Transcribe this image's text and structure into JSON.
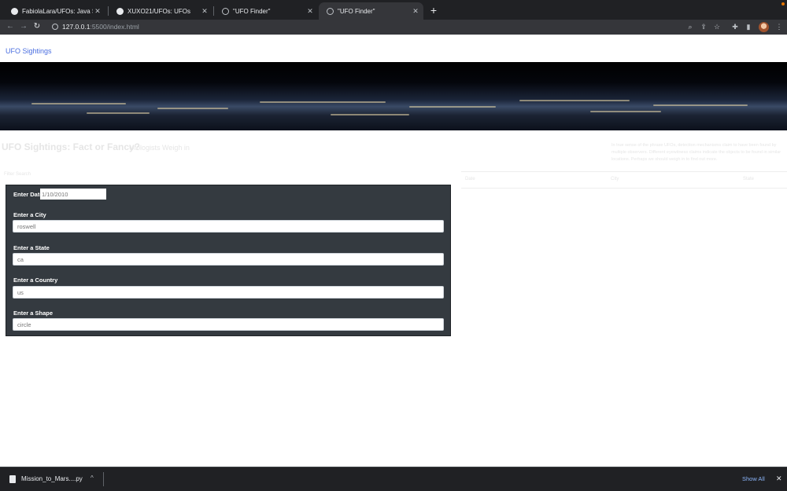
{
  "browser": {
    "tabs": [
      {
        "title": "FabiolaLara/UFOs: Java Scrip",
        "favicon": "github-icon"
      },
      {
        "title": "XUXO21/UFOs: UFOs",
        "favicon": "github-icon"
      },
      {
        "title": "\"UFO Finder\"",
        "favicon": "globe-icon"
      },
      {
        "title": "\"UFO Finder\"",
        "favicon": "globe-icon",
        "active": true
      }
    ],
    "address": {
      "host": "127.0.0.1",
      "path": ":5500/index.html"
    }
  },
  "page": {
    "brand": "UFO Sightings",
    "headline": "UFO Sightings: Fact or Fancy?",
    "subhead": "Ufologists Weigh in",
    "intro": "In true sense of the phrase UFOs, detection mechanisms claim to have been found by multiple observers. Different eyewitness claims indicate the objects to be found in similar locations. Perhaps we should weigh in to find out more.",
    "filter_label": "Filter Search",
    "filters": {
      "date": {
        "label": "Enter Date",
        "placeholder": "1/10/2010"
      },
      "city": {
        "label": "Enter a City",
        "placeholder": "roswell"
      },
      "state": {
        "label": "Enter a State",
        "placeholder": "ca"
      },
      "country": {
        "label": "Enter a Country",
        "placeholder": "us"
      },
      "shape": {
        "label": "Enter a Shape",
        "placeholder": "circle"
      }
    },
    "table": {
      "headers": [
        "Date",
        "City",
        "State"
      ]
    }
  },
  "downloads": {
    "file": "Mission_to_Mars....py",
    "show_all": "Show All"
  }
}
